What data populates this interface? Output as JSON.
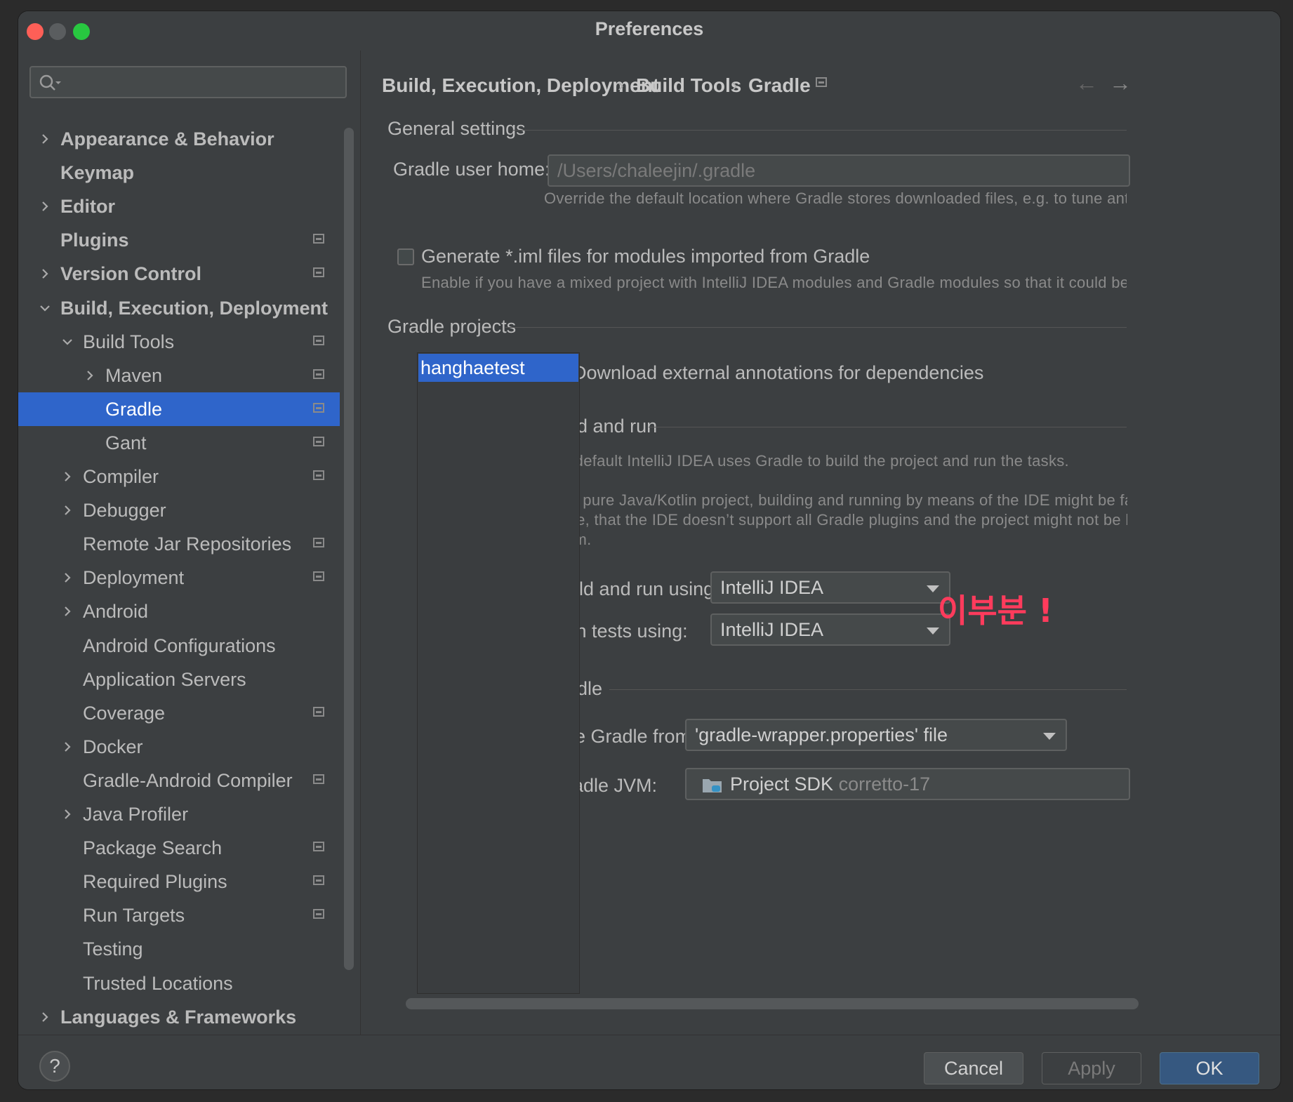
{
  "window": {
    "title": "Preferences"
  },
  "sidebar": {
    "search": {
      "value": "",
      "placeholder": ""
    },
    "items": [
      {
        "label": "Appearance & Behavior",
        "expanded": false
      },
      {
        "label": "Keymap"
      },
      {
        "label": "Editor",
        "expanded": false
      },
      {
        "label": "Plugins"
      },
      {
        "label": "Version Control",
        "expanded": false
      },
      {
        "label": "Build, Execution, Deployment",
        "expanded": true
      },
      {
        "label": "Build Tools",
        "expanded": true
      },
      {
        "label": "Maven",
        "expanded": false
      },
      {
        "label": "Gradle",
        "selected": true
      },
      {
        "label": "Gant"
      },
      {
        "label": "Compiler",
        "expanded": false
      },
      {
        "label": "Debugger",
        "expanded": false
      },
      {
        "label": "Remote Jar Repositories"
      },
      {
        "label": "Deployment",
        "expanded": false
      },
      {
        "label": "Android",
        "expanded": false
      },
      {
        "label": "Android Configurations"
      },
      {
        "label": "Application Servers"
      },
      {
        "label": "Coverage"
      },
      {
        "label": "Docker",
        "expanded": false
      },
      {
        "label": "Gradle-Android Compiler"
      },
      {
        "label": "Java Profiler",
        "expanded": false
      },
      {
        "label": "Package Search"
      },
      {
        "label": "Required Plugins"
      },
      {
        "label": "Run Targets"
      },
      {
        "label": "Testing"
      },
      {
        "label": "Trusted Locations"
      },
      {
        "label": "Languages & Frameworks",
        "expanded": false
      }
    ]
  },
  "breadcrumb": [
    "Build, Execution, Deployment",
    "Build Tools",
    "Gradle"
  ],
  "general": {
    "title": "General settings",
    "gradle_user_home_label": "Gradle user home:",
    "gradle_user_home_placeholder": "/Users/chaleejin/.gradle",
    "gradle_user_home_hint": "Override the default location where Gradle stores downloaded files, e.g. to tune anti-virus so",
    "generate_iml_label": "Generate *.iml files for modules imported from Gradle",
    "generate_iml_checked": false,
    "generate_iml_hint": "Enable if you have a mixed project with IntelliJ IDEA modules and Gradle modules so that it could be shared via V"
  },
  "projects": {
    "title": "Gradle projects",
    "list": [
      "hanghaetest"
    ],
    "download_annotations_label": "Download external annotations for dependencies",
    "download_annotations_checked": true
  },
  "build_and_run": {
    "title": "Build and run",
    "desc1": "By default IntelliJ IDEA uses Gradle to build the project and run the tasks.",
    "desc2_line1": "In a pure Java/Kotlin project, building and running by means of the IDE might be faster, than",
    "desc2_line2": "Note, that the IDE doesn’t support all Gradle plugins and the project might not be built corre",
    "desc2_line3": "them.",
    "build_run_using_label": "Build and run using:",
    "build_run_using_value": "IntelliJ IDEA",
    "run_tests_using_label": "Run tests using:",
    "run_tests_using_value": "IntelliJ IDEA"
  },
  "gradle": {
    "title": "Gradle",
    "use_gradle_from_label": "Use Gradle from:",
    "use_gradle_from_value": "'gradle-wrapper.properties' file",
    "gradle_jvm_label": "Gradle JVM:",
    "gradle_jvm_value": "Project SDK",
    "gradle_jvm_detail": "corretto-17"
  },
  "annotation": "이부분 !",
  "footer": {
    "cancel": "Cancel",
    "apply": "Apply",
    "ok": "OK",
    "help": "?"
  },
  "colors": {
    "selection": "#2f65ca",
    "background": "#3c3f41",
    "annotation": "#ff3b5c"
  }
}
